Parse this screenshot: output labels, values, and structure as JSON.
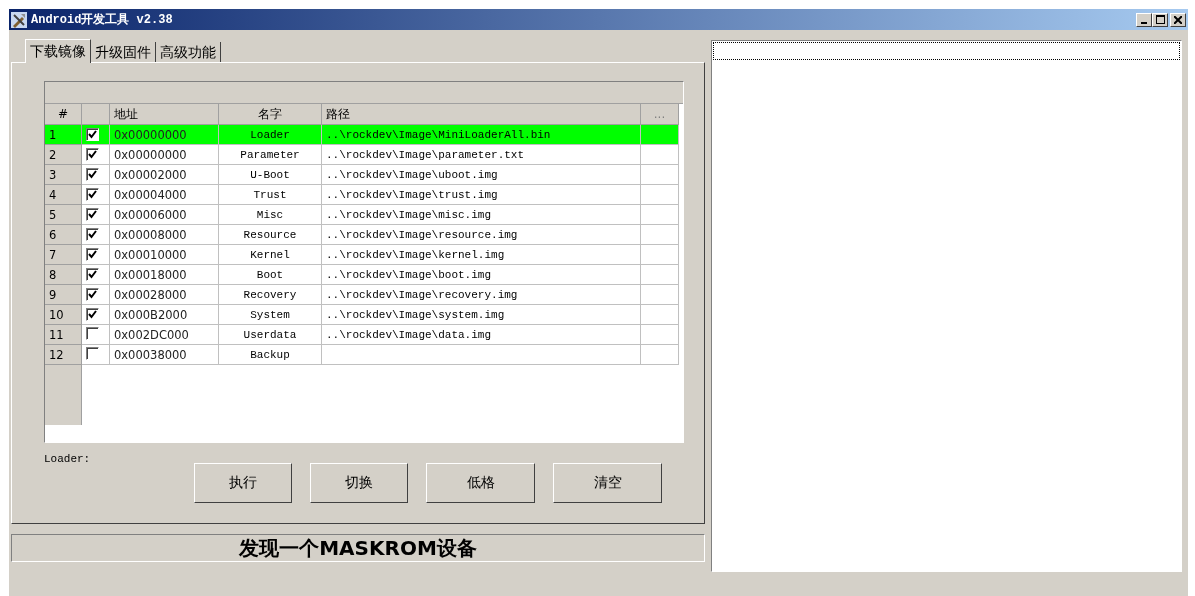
{
  "window": {
    "title": "Android开发工具 v2.38"
  },
  "tabs": [
    {
      "label": "下载镜像",
      "selected": true
    },
    {
      "label": "升级固件",
      "selected": false
    },
    {
      "label": "高级功能",
      "selected": false
    }
  ],
  "table": {
    "columns": [
      "#",
      "地址",
      "名字",
      "路径",
      "..."
    ],
    "rows": [
      {
        "index": "1",
        "checked": true,
        "address": "0x00000000",
        "name": "Loader",
        "path": "..\\rockdev\\Image\\MiniLoaderAll.bin",
        "selected": true
      },
      {
        "index": "2",
        "checked": true,
        "address": "0x00000000",
        "name": "Parameter",
        "path": "..\\rockdev\\Image\\parameter.txt",
        "selected": false
      },
      {
        "index": "3",
        "checked": true,
        "address": "0x00002000",
        "name": "U-Boot",
        "path": "..\\rockdev\\Image\\uboot.img",
        "selected": false
      },
      {
        "index": "4",
        "checked": true,
        "address": "0x00004000",
        "name": "Trust",
        "path": "..\\rockdev\\Image\\trust.img",
        "selected": false
      },
      {
        "index": "5",
        "checked": true,
        "address": "0x00006000",
        "name": "Misc",
        "path": "..\\rockdev\\Image\\misc.img",
        "selected": false
      },
      {
        "index": "6",
        "checked": true,
        "address": "0x00008000",
        "name": "Resource",
        "path": "..\\rockdev\\Image\\resource.img",
        "selected": false
      },
      {
        "index": "7",
        "checked": true,
        "address": "0x00010000",
        "name": "Kernel",
        "path": "..\\rockdev\\Image\\kernel.img",
        "selected": false
      },
      {
        "index": "8",
        "checked": true,
        "address": "0x00018000",
        "name": "Boot",
        "path": "..\\rockdev\\Image\\boot.img",
        "selected": false
      },
      {
        "index": "9",
        "checked": true,
        "address": "0x00028000",
        "name": "Recovery",
        "path": "..\\rockdev\\Image\\recovery.img",
        "selected": false
      },
      {
        "index": "10",
        "checked": true,
        "address": "0x000B2000",
        "name": "System",
        "path": "..\\rockdev\\Image\\system.img",
        "selected": false
      },
      {
        "index": "11",
        "checked": false,
        "address": "0x002DC000",
        "name": "Userdata",
        "path": "..\\rockdev\\Image\\data.img",
        "selected": false
      },
      {
        "index": "12",
        "checked": false,
        "address": "0x00038000",
        "name": "Backup",
        "selected": false
      }
    ]
  },
  "loader_label": "Loader:",
  "buttons": [
    "执行",
    "切换",
    "低格",
    "清空"
  ],
  "status": "发现一个MASKROM设备"
}
